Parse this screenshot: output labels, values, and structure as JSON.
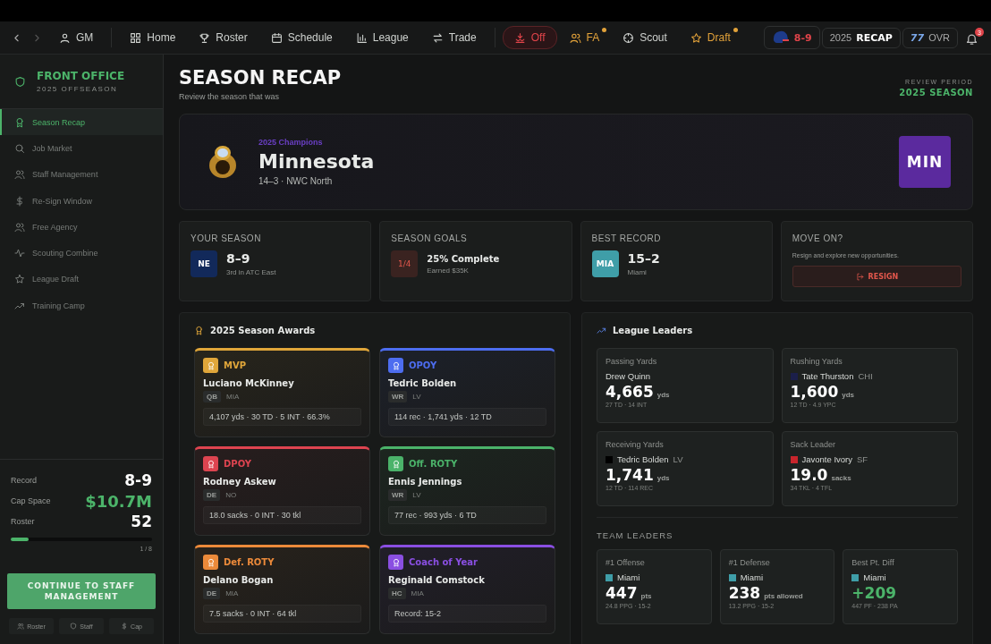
{
  "nav": {
    "items": [
      {
        "label": "GM",
        "kind": "plain",
        "dot": false
      },
      {
        "label": "Home",
        "kind": "plain",
        "dot": false
      },
      {
        "label": "Roster",
        "kind": "plain",
        "dot": false
      },
      {
        "label": "Schedule",
        "kind": "plain",
        "dot": false
      },
      {
        "label": "League",
        "kind": "plain",
        "dot": false
      },
      {
        "label": "Trade",
        "kind": "plain",
        "dot": false
      },
      {
        "label": "Off",
        "kind": "danger",
        "dot": false
      },
      {
        "label": "FA",
        "kind": "warning",
        "dot": true
      },
      {
        "label": "Scout",
        "kind": "plain",
        "dot": false
      },
      {
        "label": "Draft",
        "kind": "warning",
        "dot": true
      }
    ],
    "team_record": "8-9",
    "recap_year": "2025",
    "recap_label": "RECAP",
    "ovr": "77",
    "ovr_label": "OVR",
    "notifications": "3"
  },
  "sidebar": {
    "title": "FRONT OFFICE",
    "subtitle": "2025 OFFSEASON",
    "items": [
      {
        "label": "Season Recap",
        "selected": true
      },
      {
        "label": "Job Market",
        "selected": false
      },
      {
        "label": "Staff Management",
        "selected": false
      },
      {
        "label": "Re-Sign Window",
        "selected": false
      },
      {
        "label": "Free Agency",
        "selected": false
      },
      {
        "label": "Scouting Combine",
        "selected": false
      },
      {
        "label": "League Draft",
        "selected": false
      },
      {
        "label": "Training Camp",
        "selected": false
      }
    ],
    "stats": [
      {
        "label": "Record",
        "value": "8-9",
        "kind": "plain"
      },
      {
        "label": "Cap Space",
        "value": "$10.7M",
        "kind": "money"
      },
      {
        "label": "Roster",
        "value": "52",
        "kind": "plain"
      }
    ],
    "progress": {
      "level": 0.125,
      "reading": "1 / 8"
    },
    "continue_button": "CONTINUE TO STAFF MANAGEMENT",
    "shortcuts": [
      "Roster",
      "Staff",
      "Cap"
    ]
  },
  "header": {
    "title": "SEASON RECAP",
    "subtitle": "Review the season that was",
    "period_label": "REVIEW PERIOD",
    "period": "2025 SEASON"
  },
  "champion": {
    "kicker": "2025 Champions",
    "team": "Minnesota",
    "detail": "14–3 · NWC North",
    "abbr": "MIN",
    "color": "#5b2a9e"
  },
  "summary": [
    {
      "kind": "team",
      "title": "YOUR SEASON",
      "badge": "NE",
      "color": "#12295a",
      "value": "8–9",
      "detail": "3rd in ATC East"
    },
    {
      "kind": "goals",
      "title": "SEASON GOALS",
      "badge": "1/4",
      "color": "#3a2320",
      "value": "25% Complete",
      "detail": "Earned $35K"
    },
    {
      "kind": "team",
      "title": "BEST RECORD",
      "badge": "MIA",
      "color": "#3f9ea8",
      "value": "15–2",
      "detail": "Miami"
    },
    {
      "kind": "action",
      "title": "MOVE ON?",
      "detail": "Resign and explore new opportunities.",
      "button": "RESIGN"
    }
  ],
  "awards": {
    "title": "2025 Season Awards",
    "items": [
      {
        "award": "MVP",
        "color": "#e0a63a",
        "name": "Luciano McKinney",
        "pos": "QB",
        "team": "MIA",
        "stats": "4,107 yds · 30 TD · 5 INT · 66.3%"
      },
      {
        "award": "OPOY",
        "color": "#4d6df0",
        "name": "Tedric Bolden",
        "pos": "WR",
        "team": "LV",
        "stats": "114 rec · 1,741 yds · 12 TD"
      },
      {
        "award": "DPOY",
        "color": "#dd4450",
        "name": "Rodney Askew",
        "pos": "DE",
        "team": "NO",
        "stats": "18.0 sacks · 0 INT · 30 tkl"
      },
      {
        "award": "Off. ROTY",
        "color": "#4bb36a",
        "name": "Ennis Jennings",
        "pos": "WR",
        "team": "LV",
        "stats": "77 rec · 993 yds · 6 TD"
      },
      {
        "award": "Def. ROTY",
        "color": "#ec8a3a",
        "name": "Delano Bogan",
        "pos": "DE",
        "team": "MIA",
        "stats": "7.5 sacks · 0 INT · 64 tkl"
      },
      {
        "award": "Coach of Year",
        "color": "#8a4fe2",
        "name": "Reginald Comstock",
        "pos": "HC",
        "team": "MIA",
        "stats": "Record: 15-2"
      }
    ]
  },
  "league_leaders": {
    "title": "League Leaders",
    "items": [
      {
        "category": "Passing Yards",
        "name": "Drew Quinn",
        "value": "4,665",
        "unit": "yds",
        "detail": "27 TD · 14 INT"
      },
      {
        "category": "Rushing Yards",
        "color": "#1b1f4a",
        "name": "Tate Thurston",
        "team": "CHI",
        "value": "1,600",
        "unit": "yds",
        "detail": "12 TD · 4.9 YPC"
      },
      {
        "category": "Receiving Yards",
        "color": "#000000",
        "name": "Tedric Bolden",
        "team": "LV",
        "value": "1,741",
        "unit": "yds",
        "detail": "12 TD · 114 REC"
      },
      {
        "category": "Sack Leader",
        "color": "#c8252c",
        "name": "Javonte Ivory",
        "team": "SF",
        "value": "19.0",
        "unit": "sacks",
        "detail": "34 TKL · 4 TFL"
      }
    ],
    "team_title": "TEAM LEADERS",
    "teams": [
      {
        "category": "#1 Offense",
        "color": "#3f9ea8",
        "name": "Miami",
        "value": "447",
        "unit": "pts",
        "detail": "24.8 PPG · 15-2",
        "kind": "plain"
      },
      {
        "category": "#1 Defense",
        "color": "#3f9ea8",
        "name": "Miami",
        "value": "238",
        "unit": "pts allowed",
        "detail": "13.2 PPG · 15-2",
        "kind": "plain"
      },
      {
        "category": "Best Pt. Diff",
        "color": "#3f9ea8",
        "name": "Miami",
        "value": "+209",
        "detail": "447 PF · 238 PA",
        "kind": "positive"
      }
    ]
  }
}
